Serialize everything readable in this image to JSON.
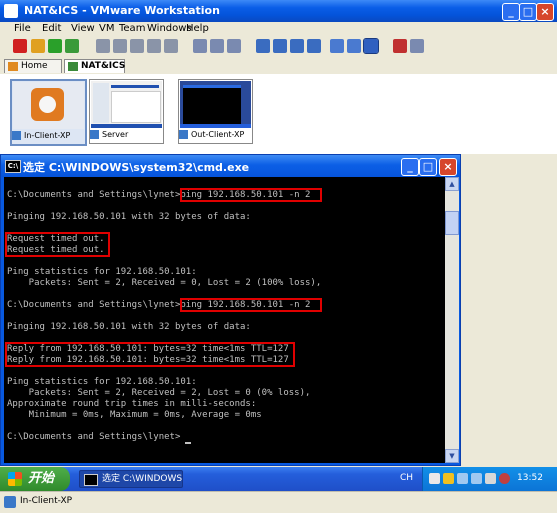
{
  "vmware": {
    "title": "NAT&ICS - VMware Workstation",
    "menu": [
      "File",
      "Edit",
      "View",
      "VM",
      "Team",
      "Windows",
      "Help"
    ],
    "tabs": [
      {
        "label": "Home",
        "active": false
      },
      {
        "label": "NAT&ICS",
        "active": true
      }
    ],
    "thumbnails": [
      {
        "label": "In-Client-XP"
      },
      {
        "label": "Server"
      },
      {
        "label": "Out-Client-XP"
      }
    ],
    "status_text": "In-Client-XP"
  },
  "cmd": {
    "title": "选定 C:\\WINDOWS\\system32\\cmd.exe",
    "lines": [
      "",
      "C:\\Documents and Settings\\lynet>ping 192.168.50.101 -n 2",
      "",
      "Pinging 192.168.50.101 with 32 bytes of data:",
      "",
      "Request timed out.",
      "Request timed out.",
      "",
      "Ping statistics for 192.168.50.101:",
      "    Packets: Sent = 2, Received = 0, Lost = 2 (100% loss),",
      "",
      "C:\\Documents and Settings\\lynet>ping 192.168.50.101 -n 2",
      "",
      "Pinging 192.168.50.101 with 32 bytes of data:",
      "",
      "Reply from 192.168.50.101: bytes=32 time<1ms TTL=127",
      "Reply from 192.168.50.101: bytes=32 time<1ms TTL=127",
      "",
      "Ping statistics for 192.168.50.101:",
      "    Packets: Sent = 2, Received = 2, Lost = 0 (0% loss),",
      "Approximate round trip times in milli-seconds:",
      "    Minimum = 0ms, Maximum = 0ms, Average = 0ms",
      "",
      "C:\\Documents and Settings\\lynet>"
    ]
  },
  "taskbar": {
    "start_label": "开始",
    "task_label": "选定 C:\\WINDOWS\\...",
    "lang": "CH",
    "clock": "13:52"
  },
  "colors": {
    "xp_blue": "#0a5ee8",
    "highlight_red": "#e00000",
    "console_text": "#c0c0c0",
    "start_green": "#3a9a35"
  }
}
